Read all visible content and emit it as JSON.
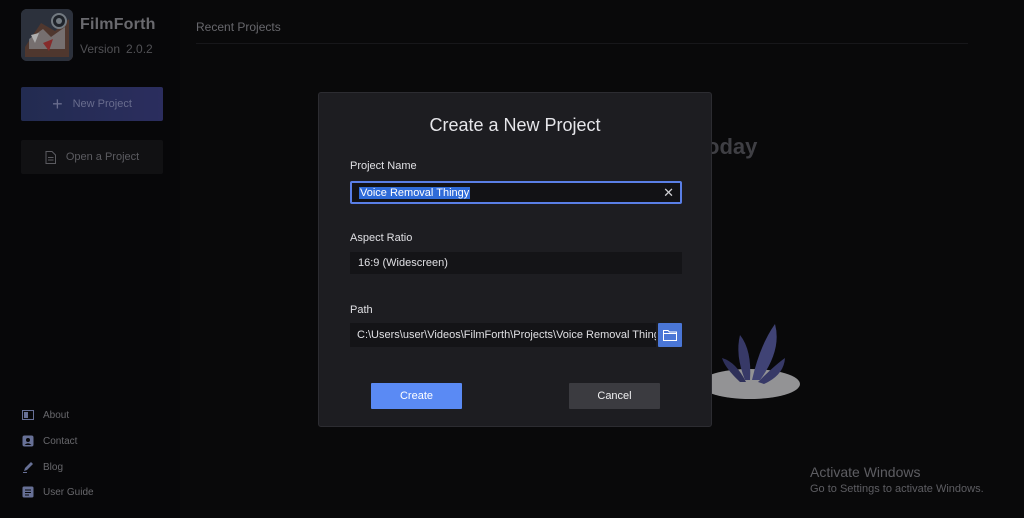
{
  "app": {
    "name": "FilmForth",
    "version_label": "Version",
    "version": "2.0.2"
  },
  "sidebar": {
    "new_project": "New Project",
    "open_project": "Open a Project",
    "links": [
      {
        "label": "About",
        "icon": "about-icon"
      },
      {
        "label": "Contact",
        "icon": "contact-icon"
      },
      {
        "label": "Blog",
        "icon": "pen-icon"
      },
      {
        "label": "User Guide",
        "icon": "guide-icon"
      }
    ]
  },
  "main": {
    "recent_header": "Recent Projects",
    "background_heading": "oday"
  },
  "modal": {
    "title": "Create a New Project",
    "project_name_label": "Project Name",
    "project_name_value": "Voice Removal Thingy",
    "aspect_ratio_label": "Aspect Ratio",
    "aspect_ratio_value": "16:9 (Widescreen)",
    "path_label": "Path",
    "path_value": "C:\\Users\\user\\Videos\\FilmForth\\Projects\\Voice Removal Thingy",
    "create_label": "Create",
    "cancel_label": "Cancel"
  },
  "watermark": {
    "title": "Activate Windows",
    "subtitle": "Go to Settings to activate Windows."
  },
  "colors": {
    "accent": "#5a8af4",
    "folder_button": "#4a76d6",
    "selection": "#2f6bd8",
    "background": "#0c0c0e",
    "modal_background": "#1d1d21"
  }
}
